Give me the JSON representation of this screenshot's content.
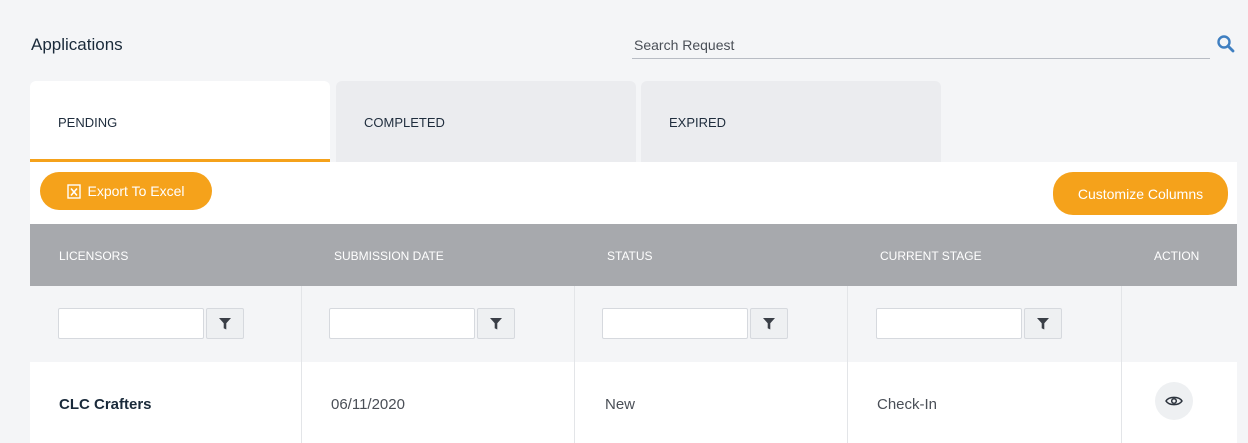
{
  "header": {
    "title": "Applications"
  },
  "search": {
    "placeholder": "Search Request",
    "value": ""
  },
  "tabs": [
    {
      "label": "PENDING",
      "active": true
    },
    {
      "label": "COMPLETED",
      "active": false
    },
    {
      "label": "EXPIRED",
      "active": false
    }
  ],
  "toolbar": {
    "export_label": "Export To Excel",
    "customize_label": "Customize Columns"
  },
  "table": {
    "columns": [
      "LICENSORS",
      "SUBMISSION DATE",
      "STATUS",
      "CURRENT STAGE",
      "ACTION"
    ],
    "rows": [
      {
        "licensor": "CLC Crafters",
        "submission_date": "06/11/2020",
        "status": "New",
        "current_stage": "Check-In"
      }
    ]
  },
  "colors": {
    "accent": "#f5a21b",
    "header_bg": "#a7a9ad",
    "page_bg": "#f4f5f7"
  },
  "icons": {
    "search": "search-icon",
    "filter": "filter-icon",
    "view": "eye-icon",
    "excel": "excel-file-icon"
  }
}
